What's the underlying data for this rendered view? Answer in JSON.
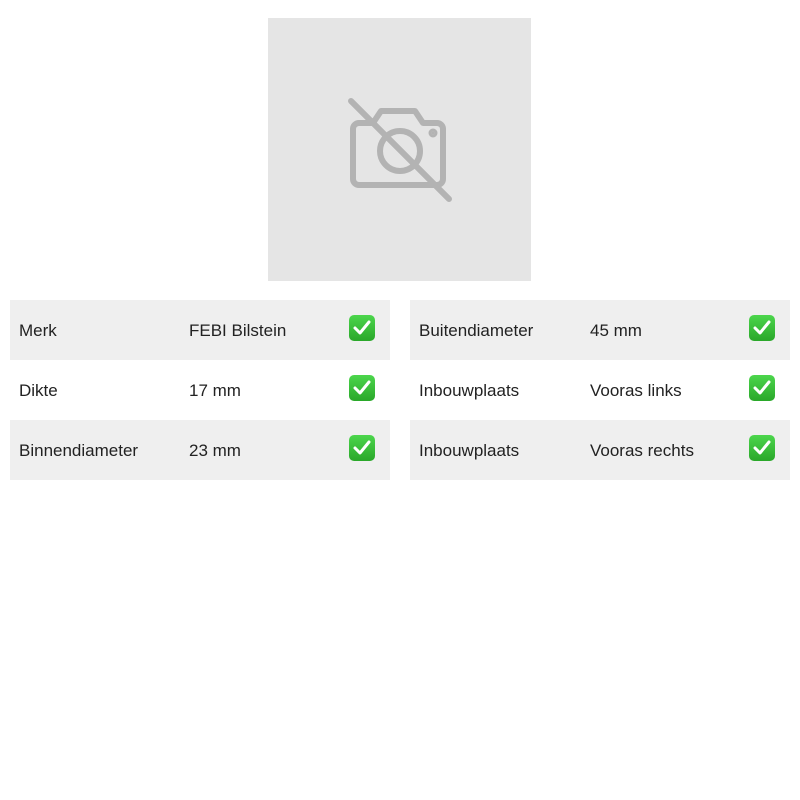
{
  "product_image": {
    "icon": "no-photo-icon"
  },
  "specs_left": [
    {
      "label": "Merk",
      "value": "FEBI Bilstein",
      "checked": true
    },
    {
      "label": "Dikte",
      "value": "17 mm",
      "checked": true
    },
    {
      "label": "Binnendiameter",
      "value": "23 mm",
      "checked": true
    }
  ],
  "specs_right": [
    {
      "label": "Buitendiameter",
      "value": "45 mm",
      "checked": true
    },
    {
      "label": "Inbouwplaats",
      "value": "Vooras links",
      "checked": true
    },
    {
      "label": "Inbouwplaats",
      "value": "Vooras rechts",
      "checked": true
    }
  ],
  "colors": {
    "row_shade": "#efefef",
    "placeholder_bg": "#e5e5e5",
    "icon_gray": "#b3b3b3",
    "check_green": "#3cbf3c"
  }
}
